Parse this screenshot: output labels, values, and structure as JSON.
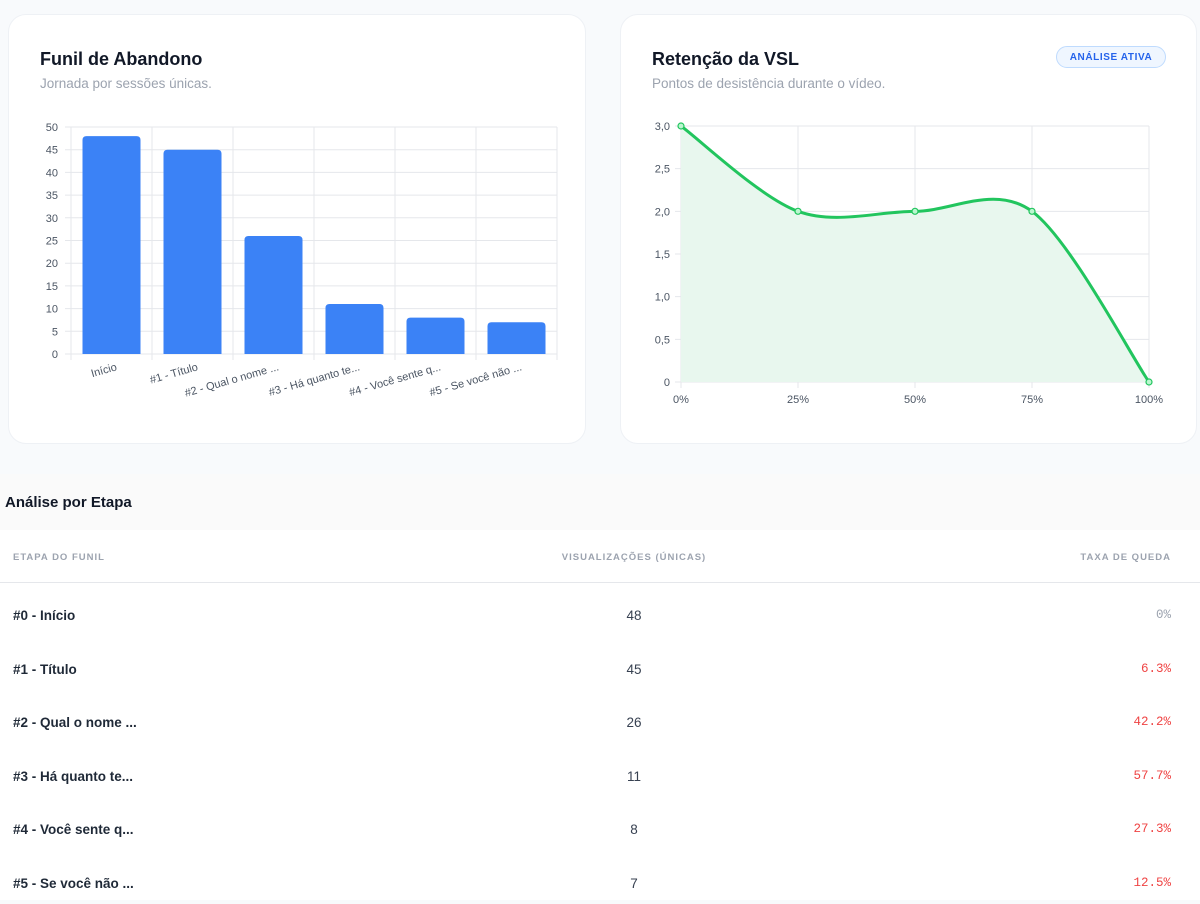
{
  "funnel_card": {
    "title": "Funil de Abandono",
    "subtitle": "Jornada por sessões únicas."
  },
  "vsl_card": {
    "title": "Retenção da VSL",
    "subtitle": "Pontos de desistência durante o vídeo.",
    "badge": "ANÁLISE ATIVA"
  },
  "chart_data": [
    {
      "type": "bar",
      "title": "Funil de Abandono",
      "categories": [
        "Início",
        "#1 - Título",
        "#2 - Qual o nome ...",
        "#3 - Há quanto te...",
        "#4 - Você sente q...",
        "#5 - Se você não ..."
      ],
      "values": [
        48,
        45,
        26,
        11,
        8,
        7
      ],
      "yticks": [
        "0",
        "5",
        "10",
        "15",
        "20",
        "25",
        "30",
        "35",
        "40",
        "45",
        "50"
      ],
      "ylim": [
        0,
        50
      ],
      "grid": true,
      "color": "#3b82f6"
    },
    {
      "type": "area",
      "title": "Retenção da VSL",
      "x": [
        "0%",
        "25%",
        "50%",
        "75%",
        "100%"
      ],
      "values": [
        3.0,
        2.0,
        2.0,
        2.0,
        0
      ],
      "yticks": [
        "0",
        "0,5",
        "1,0",
        "1,5",
        "2,0",
        "2,5",
        "3,0"
      ],
      "ylim": [
        0,
        3
      ],
      "grid": true,
      "color": "#22c55e",
      "fill_color": "#e8f7ee"
    }
  ],
  "table": {
    "title": "Análise por Etapa",
    "columns": [
      "ETAPA DO FUNIL",
      "VISUALIZAÇÕES (ÚNICAS)",
      "TAXA DE QUEDA"
    ],
    "rows": [
      {
        "stage": "#0 - Início",
        "views": "48",
        "drop": "0%",
        "drop_color": "#9ca3af"
      },
      {
        "stage": "#1 - Título",
        "views": "45",
        "drop": "6.3%",
        "drop_color": "#ef4444"
      },
      {
        "stage": "#2 - Qual o nome ...",
        "views": "26",
        "drop": "42.2%",
        "drop_color": "#ef4444"
      },
      {
        "stage": "#3 - Há quanto te...",
        "views": "11",
        "drop": "57.7%",
        "drop_color": "#ef4444"
      },
      {
        "stage": "#4 - Você sente q...",
        "views": "8",
        "drop": "27.3%",
        "drop_color": "#ef4444"
      },
      {
        "stage": "#5 - Se você não ...",
        "views": "7",
        "drop": "12.5%",
        "drop_color": "#ef4444"
      }
    ]
  }
}
